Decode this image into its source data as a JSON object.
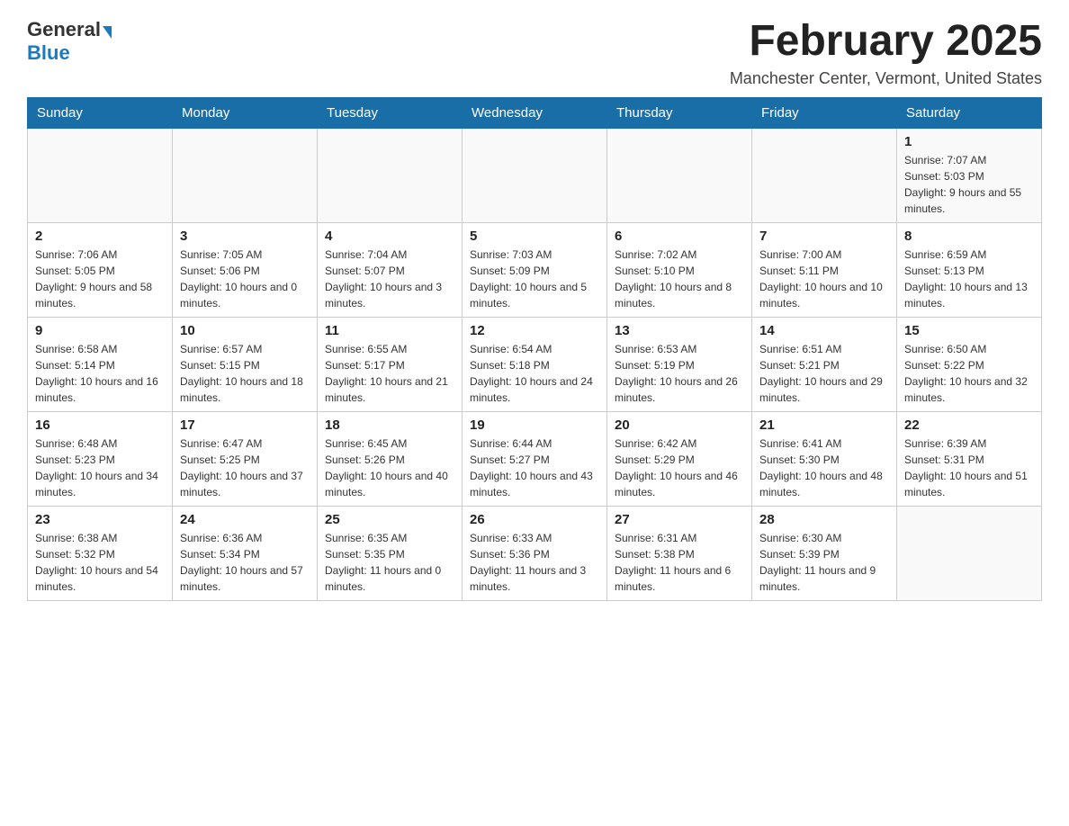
{
  "logo": {
    "general": "General",
    "blue": "Blue"
  },
  "title": "February 2025",
  "location": "Manchester Center, Vermont, United States",
  "days_of_week": [
    "Sunday",
    "Monday",
    "Tuesday",
    "Wednesday",
    "Thursday",
    "Friday",
    "Saturday"
  ],
  "weeks": [
    [
      {
        "day": "",
        "sunrise": "",
        "sunset": "",
        "daylight": ""
      },
      {
        "day": "",
        "sunrise": "",
        "sunset": "",
        "daylight": ""
      },
      {
        "day": "",
        "sunrise": "",
        "sunset": "",
        "daylight": ""
      },
      {
        "day": "",
        "sunrise": "",
        "sunset": "",
        "daylight": ""
      },
      {
        "day": "",
        "sunrise": "",
        "sunset": "",
        "daylight": ""
      },
      {
        "day": "",
        "sunrise": "",
        "sunset": "",
        "daylight": ""
      },
      {
        "day": "1",
        "sunrise": "Sunrise: 7:07 AM",
        "sunset": "Sunset: 5:03 PM",
        "daylight": "Daylight: 9 hours and 55 minutes."
      }
    ],
    [
      {
        "day": "2",
        "sunrise": "Sunrise: 7:06 AM",
        "sunset": "Sunset: 5:05 PM",
        "daylight": "Daylight: 9 hours and 58 minutes."
      },
      {
        "day": "3",
        "sunrise": "Sunrise: 7:05 AM",
        "sunset": "Sunset: 5:06 PM",
        "daylight": "Daylight: 10 hours and 0 minutes."
      },
      {
        "day": "4",
        "sunrise": "Sunrise: 7:04 AM",
        "sunset": "Sunset: 5:07 PM",
        "daylight": "Daylight: 10 hours and 3 minutes."
      },
      {
        "day": "5",
        "sunrise": "Sunrise: 7:03 AM",
        "sunset": "Sunset: 5:09 PM",
        "daylight": "Daylight: 10 hours and 5 minutes."
      },
      {
        "day": "6",
        "sunrise": "Sunrise: 7:02 AM",
        "sunset": "Sunset: 5:10 PM",
        "daylight": "Daylight: 10 hours and 8 minutes."
      },
      {
        "day": "7",
        "sunrise": "Sunrise: 7:00 AM",
        "sunset": "Sunset: 5:11 PM",
        "daylight": "Daylight: 10 hours and 10 minutes."
      },
      {
        "day": "8",
        "sunrise": "Sunrise: 6:59 AM",
        "sunset": "Sunset: 5:13 PM",
        "daylight": "Daylight: 10 hours and 13 minutes."
      }
    ],
    [
      {
        "day": "9",
        "sunrise": "Sunrise: 6:58 AM",
        "sunset": "Sunset: 5:14 PM",
        "daylight": "Daylight: 10 hours and 16 minutes."
      },
      {
        "day": "10",
        "sunrise": "Sunrise: 6:57 AM",
        "sunset": "Sunset: 5:15 PM",
        "daylight": "Daylight: 10 hours and 18 minutes."
      },
      {
        "day": "11",
        "sunrise": "Sunrise: 6:55 AM",
        "sunset": "Sunset: 5:17 PM",
        "daylight": "Daylight: 10 hours and 21 minutes."
      },
      {
        "day": "12",
        "sunrise": "Sunrise: 6:54 AM",
        "sunset": "Sunset: 5:18 PM",
        "daylight": "Daylight: 10 hours and 24 minutes."
      },
      {
        "day": "13",
        "sunrise": "Sunrise: 6:53 AM",
        "sunset": "Sunset: 5:19 PM",
        "daylight": "Daylight: 10 hours and 26 minutes."
      },
      {
        "day": "14",
        "sunrise": "Sunrise: 6:51 AM",
        "sunset": "Sunset: 5:21 PM",
        "daylight": "Daylight: 10 hours and 29 minutes."
      },
      {
        "day": "15",
        "sunrise": "Sunrise: 6:50 AM",
        "sunset": "Sunset: 5:22 PM",
        "daylight": "Daylight: 10 hours and 32 minutes."
      }
    ],
    [
      {
        "day": "16",
        "sunrise": "Sunrise: 6:48 AM",
        "sunset": "Sunset: 5:23 PM",
        "daylight": "Daylight: 10 hours and 34 minutes."
      },
      {
        "day": "17",
        "sunrise": "Sunrise: 6:47 AM",
        "sunset": "Sunset: 5:25 PM",
        "daylight": "Daylight: 10 hours and 37 minutes."
      },
      {
        "day": "18",
        "sunrise": "Sunrise: 6:45 AM",
        "sunset": "Sunset: 5:26 PM",
        "daylight": "Daylight: 10 hours and 40 minutes."
      },
      {
        "day": "19",
        "sunrise": "Sunrise: 6:44 AM",
        "sunset": "Sunset: 5:27 PM",
        "daylight": "Daylight: 10 hours and 43 minutes."
      },
      {
        "day": "20",
        "sunrise": "Sunrise: 6:42 AM",
        "sunset": "Sunset: 5:29 PM",
        "daylight": "Daylight: 10 hours and 46 minutes."
      },
      {
        "day": "21",
        "sunrise": "Sunrise: 6:41 AM",
        "sunset": "Sunset: 5:30 PM",
        "daylight": "Daylight: 10 hours and 48 minutes."
      },
      {
        "day": "22",
        "sunrise": "Sunrise: 6:39 AM",
        "sunset": "Sunset: 5:31 PM",
        "daylight": "Daylight: 10 hours and 51 minutes."
      }
    ],
    [
      {
        "day": "23",
        "sunrise": "Sunrise: 6:38 AM",
        "sunset": "Sunset: 5:32 PM",
        "daylight": "Daylight: 10 hours and 54 minutes."
      },
      {
        "day": "24",
        "sunrise": "Sunrise: 6:36 AM",
        "sunset": "Sunset: 5:34 PM",
        "daylight": "Daylight: 10 hours and 57 minutes."
      },
      {
        "day": "25",
        "sunrise": "Sunrise: 6:35 AM",
        "sunset": "Sunset: 5:35 PM",
        "daylight": "Daylight: 11 hours and 0 minutes."
      },
      {
        "day": "26",
        "sunrise": "Sunrise: 6:33 AM",
        "sunset": "Sunset: 5:36 PM",
        "daylight": "Daylight: 11 hours and 3 minutes."
      },
      {
        "day": "27",
        "sunrise": "Sunrise: 6:31 AM",
        "sunset": "Sunset: 5:38 PM",
        "daylight": "Daylight: 11 hours and 6 minutes."
      },
      {
        "day": "28",
        "sunrise": "Sunrise: 6:30 AM",
        "sunset": "Sunset: 5:39 PM",
        "daylight": "Daylight: 11 hours and 9 minutes."
      },
      {
        "day": "",
        "sunrise": "",
        "sunset": "",
        "daylight": ""
      }
    ]
  ]
}
